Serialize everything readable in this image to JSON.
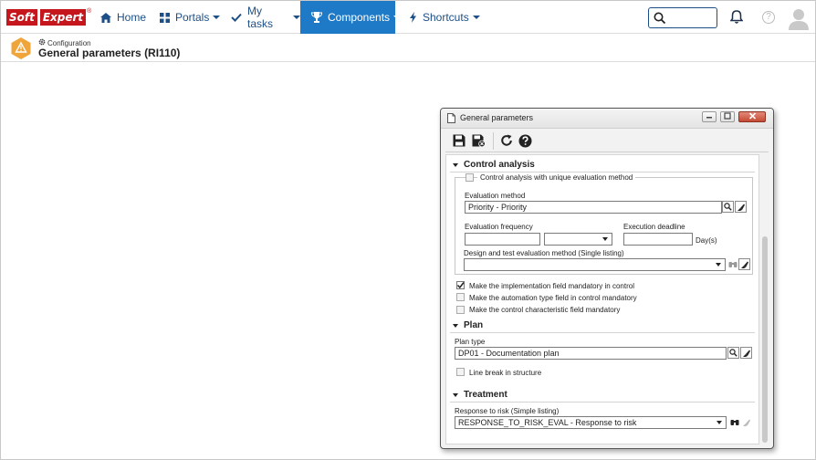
{
  "logo": {
    "part1": "Soft",
    "part2": "Expert",
    "reg": "®"
  },
  "nav": {
    "home": "Home",
    "portals": "Portals",
    "my_tasks": "My tasks",
    "components": "Components",
    "shortcuts": "Shortcuts"
  },
  "colors": {
    "brand": "#c4161c",
    "nav_text": "#1d4f86",
    "active_tab": "#1e79c7",
    "warning": "#f0a53a"
  },
  "page": {
    "breadcrumb": "Configuration",
    "title": "General parameters (RI110)"
  },
  "dialog": {
    "title": "General parameters",
    "sections": {
      "control_analysis": {
        "header": "Control analysis",
        "unique_method_label": "Control analysis with unique evaluation method",
        "evaluation_method_label": "Evaluation method",
        "evaluation_method_value": "Priority - Priority",
        "evaluation_frequency_label": "Evaluation frequency",
        "evaluation_frequency_value": "",
        "evaluation_frequency_unit": "",
        "execution_deadline_label": "Execution deadline",
        "execution_deadline_value": "",
        "days_label": "Day(s)",
        "design_test_label": "Design and test evaluation method (Single listing)",
        "design_test_value": "",
        "opt_implementation": "Make the implementation field mandatory in control",
        "opt_automation": "Make the automation type field in control mandatory",
        "opt_characteristic": "Make the control characteristic field mandatory"
      },
      "plan": {
        "header": "Plan",
        "plan_type_label": "Plan type",
        "plan_type_value": "DP01 - Documentation plan",
        "line_break_label": "Line break in structure"
      },
      "treatment": {
        "header": "Treatment",
        "response_label": "Response to risk (Simple listing)",
        "response_value": "RESPONSE_TO_RISK_EVAL - Response to risk"
      }
    },
    "checkbox_states": {
      "unique_method": false,
      "implementation": true,
      "automation": false,
      "characteristic": false,
      "line_break": false
    }
  }
}
